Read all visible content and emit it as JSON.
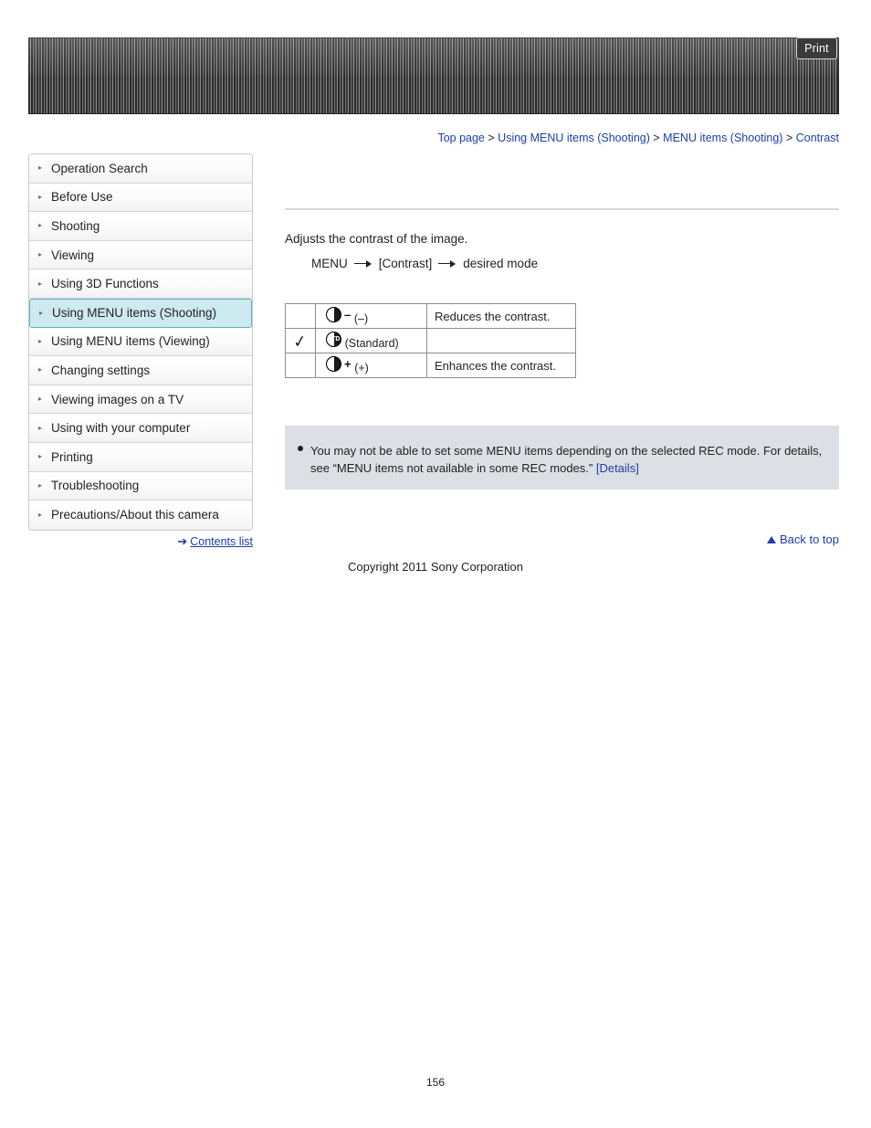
{
  "banner": {
    "print_label": "Print"
  },
  "breadcrumb": {
    "items": [
      {
        "label": "Top page",
        "link": true
      },
      {
        "label": "Using MENU items (Shooting)",
        "link": true
      },
      {
        "label": "MENU items (Shooting)",
        "link": true
      },
      {
        "label": "Contrast",
        "link": true
      }
    ],
    "separator": ">"
  },
  "sidebar": {
    "items": [
      {
        "label": "Operation Search",
        "active": false
      },
      {
        "label": "Before Use",
        "active": false
      },
      {
        "label": "Shooting",
        "active": false
      },
      {
        "label": "Viewing",
        "active": false
      },
      {
        "label": "Using 3D Functions",
        "active": false
      },
      {
        "label": "Using MENU items (Shooting)",
        "active": true
      },
      {
        "label": "Using MENU items (Viewing)",
        "active": false
      },
      {
        "label": "Changing settings",
        "active": false
      },
      {
        "label": "Viewing images on a TV",
        "active": false
      },
      {
        "label": "Using with your computer",
        "active": false
      },
      {
        "label": "Printing",
        "active": false
      },
      {
        "label": "Troubleshooting",
        "active": false
      },
      {
        "label": "Precautions/About this camera",
        "active": false
      }
    ],
    "contents_list_label": "Contents list"
  },
  "main": {
    "intro": "Adjusts the contrast of the image.",
    "menu_path": {
      "menu": "MENU",
      "bracket_item": "[Contrast]",
      "tail": "desired mode"
    },
    "options": [
      {
        "checked": false,
        "icon": "contrast-minus-icon",
        "icon_sign": "–",
        "icon_std_text": "",
        "mode_text": "(–)",
        "description": "Reduces the contrast."
      },
      {
        "checked": true,
        "icon": "contrast-standard-icon",
        "icon_sign": "",
        "icon_std_text": "STD",
        "mode_text": "(Standard)",
        "description": ""
      },
      {
        "checked": false,
        "icon": "contrast-plus-icon",
        "icon_sign": "+",
        "icon_std_text": "",
        "mode_text": "(+)",
        "description": "Enhances the contrast."
      }
    ],
    "note": {
      "text": "You may not be able to set some MENU items depending on the selected REC mode. For details, see “MENU items not available in some REC modes.” ",
      "link_label": "[Details]"
    }
  },
  "footer": {
    "back_to_top": "Back to top",
    "copyright": "Copyright 2011 Sony Corporation",
    "page_number": "156"
  },
  "colors": {
    "link": "#1b3faa",
    "active_nav_bg": "#cdeaf0",
    "active_nav_border": "#5fb3c4",
    "note_bg": "#dcdfe4"
  }
}
